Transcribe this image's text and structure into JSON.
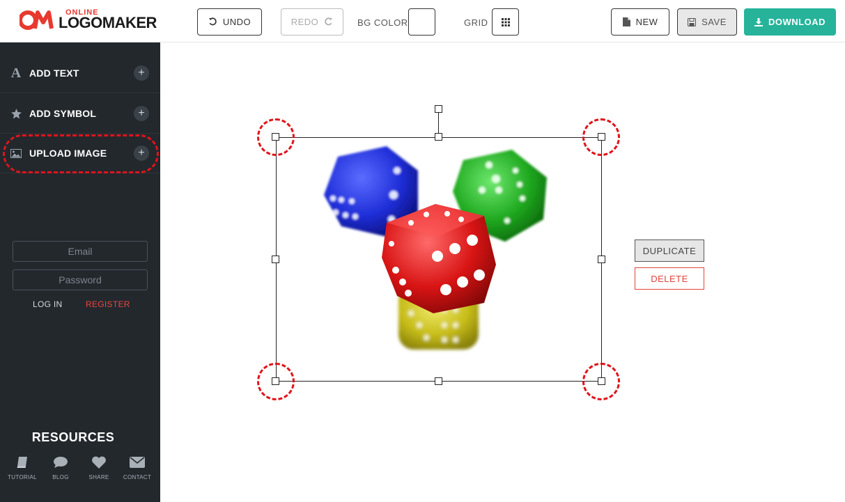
{
  "logo": {
    "small": "ONLINE",
    "big": "LOGOMAKER",
    "mark": "OM"
  },
  "toolbar": {
    "undo_label": "UNDO",
    "redo_label": "REDO",
    "bg_color_label": "BG COLOR",
    "grid_label": "GRID",
    "new_label": "NEW",
    "save_label": "SAVE",
    "download_label": "DOWNLOAD"
  },
  "sidebar": {
    "items": [
      {
        "label": "ADD TEXT",
        "icon": "letter-a-icon"
      },
      {
        "label": "ADD SYMBOL",
        "icon": "star-icon"
      },
      {
        "label": "UPLOAD IMAGE",
        "icon": "image-icon"
      }
    ],
    "login": {
      "email_placeholder": "Email",
      "password_placeholder": "Password",
      "login_label": "LOG IN",
      "register_label": "REGISTER"
    },
    "resources": {
      "title": "RESOURCES",
      "items": [
        {
          "label": "TUTORIAL",
          "icon": "book-icon"
        },
        {
          "label": "BLOG",
          "icon": "chat-bubble-icon"
        },
        {
          "label": "SHARE",
          "icon": "heart-icon"
        },
        {
          "label": "CONTACT",
          "icon": "envelope-icon"
        }
      ]
    }
  },
  "canvas": {
    "duplicate_label": "DUPLICATE",
    "delete_label": "DELETE",
    "image": "dice-image"
  },
  "colors": {
    "accent_green": "#26b39a",
    "register_red": "#e8493b",
    "highlight_red": "#e0141b",
    "sidebar_bg": "#23282d"
  }
}
